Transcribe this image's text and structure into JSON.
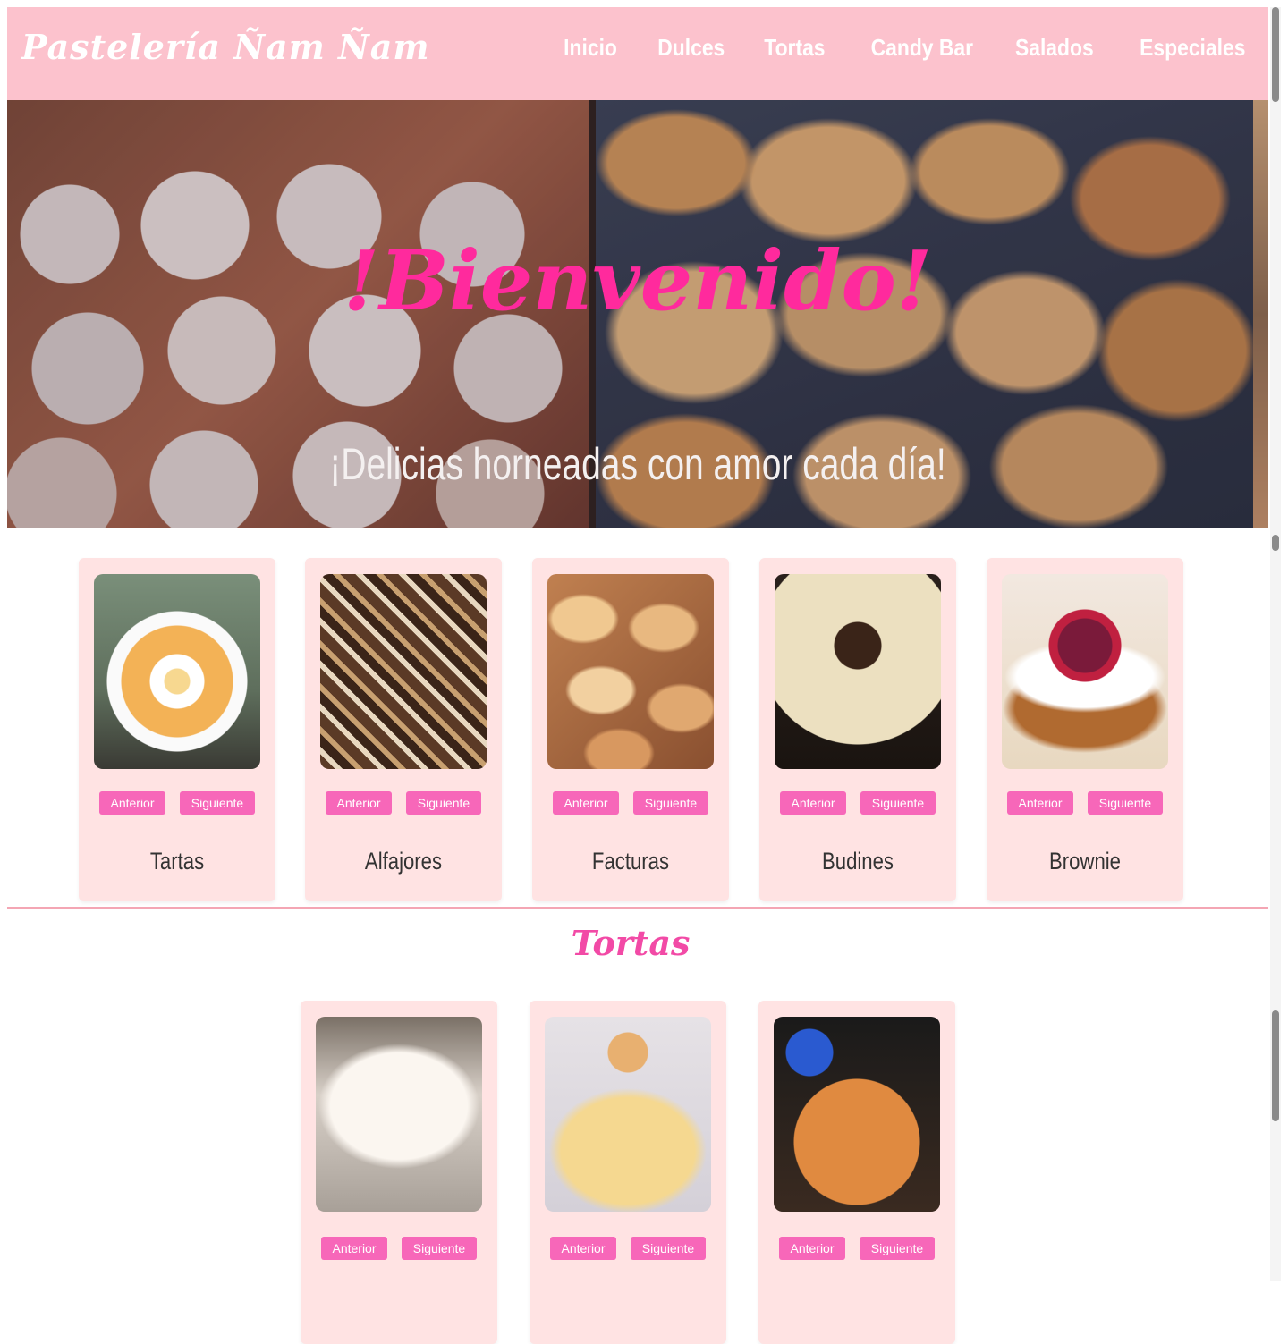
{
  "navbar": {
    "brand": "Pastelería Ñam Ñam",
    "links": [
      "Inicio",
      "Dulces",
      "Tortas",
      "Candy Bar",
      "Salados",
      "Especiales"
    ]
  },
  "hero": {
    "title": "!Bienvenido!",
    "subtitle": "¡Delicias horneadas con amor cada día!"
  },
  "buttons": {
    "prev": "Anterior",
    "next": "Siguiente"
  },
  "dulces": {
    "cards": [
      {
        "title": "Tartas"
      },
      {
        "title": "Alfajores"
      },
      {
        "title": "Facturas"
      },
      {
        "title": "Budines"
      },
      {
        "title": "Brownie"
      }
    ]
  },
  "tortas": {
    "title": "Tortas",
    "cards": [
      {},
      {},
      {}
    ]
  },
  "colors": {
    "navbar_bg": "#fcc2cd",
    "accent_pink": "#f767b9",
    "hero_title": "#ff2a9d",
    "card_bg": "#ffe3e3"
  }
}
